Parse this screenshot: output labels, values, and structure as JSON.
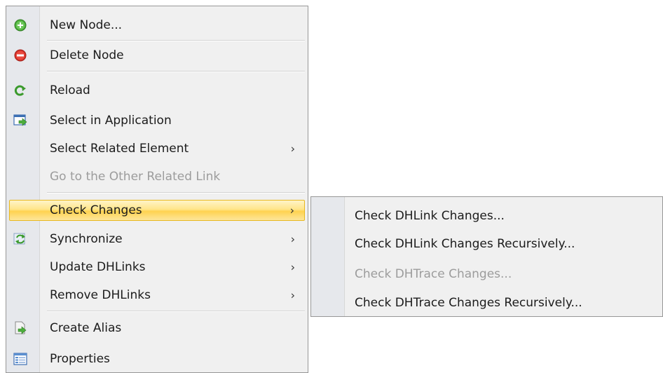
{
  "context_menu": {
    "items": [
      {
        "label": "New Node...",
        "icon": "add-node-icon"
      },
      {
        "label": "Delete Node",
        "icon": "delete-node-icon"
      },
      {
        "label": "Reload",
        "icon": "reload-icon"
      },
      {
        "label": "Select in Application",
        "icon": "select-in-application-icon"
      },
      {
        "label": "Select Related Element",
        "submenu_arrow": "›"
      },
      {
        "label": "Go to the Other Related Link",
        "disabled": true
      },
      {
        "label": "Check Changes",
        "submenu_arrow": "›",
        "highlighted": true
      },
      {
        "label": "Synchronize",
        "icon": "synchronize-icon",
        "submenu_arrow": "›"
      },
      {
        "label": "Update DHLinks",
        "submenu_arrow": "›"
      },
      {
        "label": "Remove DHLinks",
        "submenu_arrow": "›"
      },
      {
        "label": "Create Alias",
        "icon": "create-alias-icon"
      },
      {
        "label": "Properties",
        "icon": "properties-icon"
      }
    ]
  },
  "submenu": {
    "items": [
      {
        "label": "Check DHLink Changes..."
      },
      {
        "label": "Check DHLink Changes Recursively..."
      },
      {
        "label": "Check DHTrace Changes...",
        "disabled": true
      },
      {
        "label": "Check DHTrace Changes Recursively..."
      }
    ]
  },
  "colors": {
    "menu_background": "#f0f0f0",
    "highlight_border": "#e8b820",
    "highlight_fill": "#ffd250",
    "disabled_text": "#9c9c9c"
  }
}
